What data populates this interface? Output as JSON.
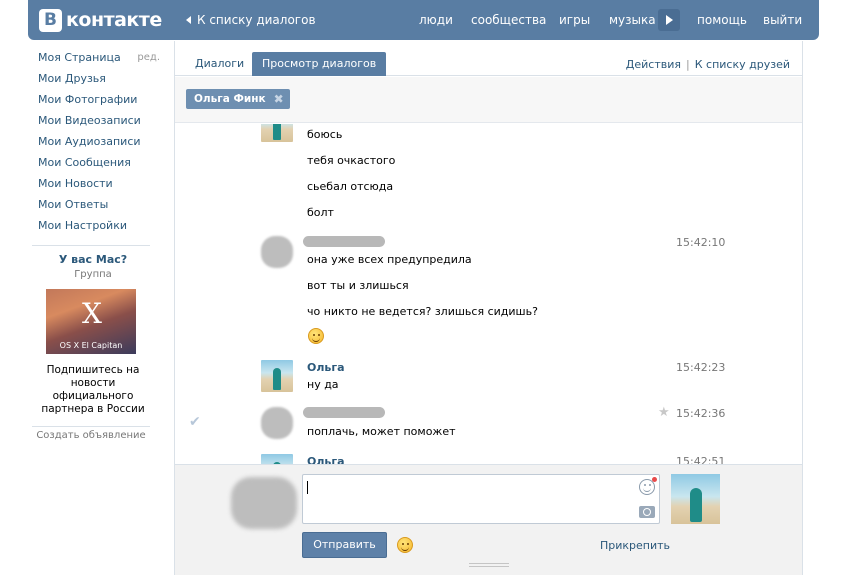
{
  "header": {
    "logo_letter": "В",
    "logo_text": "контакте",
    "back_link": "К списку диалогов",
    "nav": [
      "люди",
      "сообщества",
      "игры",
      "музыка",
      "помощь",
      "выйти"
    ]
  },
  "left_menu": {
    "items": [
      "Моя Страница",
      "Мои Друзья",
      "Мои Фотографии",
      "Мои Видеозаписи",
      "Мои Аудиозаписи",
      "Мои Сообщения",
      "Мои Новости",
      "Мои Ответы",
      "Мои Настройки"
    ],
    "edit_label": "ред."
  },
  "ad": {
    "title": "У вас Mac?",
    "subtitle": "Группа",
    "image_caption": "OS X El Capitan",
    "text": "Подпишитесь на новости официального партнера в России",
    "create_ad": "Создать объявление"
  },
  "tabs": {
    "dialogs": "Диалоги",
    "view": "Просмотр диалогов",
    "actions": "Действия",
    "friends": "К списку друзей"
  },
  "peer": {
    "name": "Ольга Финк",
    "remove_icon": "✖"
  },
  "messages": {
    "g1": [
      "боюсь",
      "тебя очкастого",
      "сьебал отсюда",
      "болт"
    ],
    "g2_time": "15:42:10",
    "g2": [
      "она уже всех предупредила",
      "вот ты и злишься",
      "чо никто не ведется? злишься сидишь?"
    ],
    "g3_author": "Ольга",
    "g3_time": "15:42:23",
    "g3": [
      "ну да"
    ],
    "g4_time": "15:42:36",
    "g4": [
      "поплачь, может поможет"
    ],
    "g5_author": "Ольга",
    "g5_time": "15:42:51"
  },
  "compose": {
    "send": "Отправить",
    "attach": "Прикрепить"
  },
  "colors": {
    "header_bg": "#597da3",
    "link": "#2b587a",
    "tab_active": "#597da3"
  }
}
